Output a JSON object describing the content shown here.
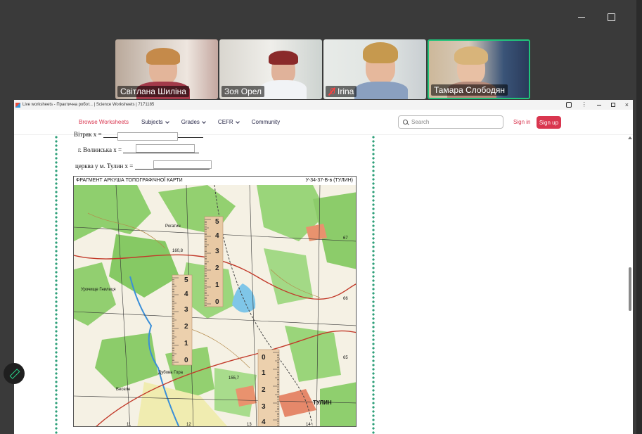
{
  "participants": [
    {
      "name": "Світлана Шиліна",
      "muted": false
    },
    {
      "name": "Зоя Орел",
      "muted": false
    },
    {
      "name": "Irina",
      "muted": true
    },
    {
      "name": "Тамара Слободян",
      "muted": false,
      "speaking": true
    }
  ],
  "browser": {
    "tab_title": "Live worksheets - Практична робот... | Science Worksheets | 7171185"
  },
  "navbar": {
    "browse": "Browse Worksheets",
    "subjects": "Subjects",
    "grades": "Grades",
    "cefr": "CEFR",
    "community": "Community",
    "search_placeholder": "Search",
    "signin": "Sign in",
    "signup": "Sign up"
  },
  "worksheet": {
    "line1": "Вітряк х =",
    "line2": "г. Волинська х =",
    "line3": "церква у м. Тулин  х =",
    "map_title": "ФРАГМЕНТ АРКУША ТОПОГРАФІЧНОЇ КАРТИ",
    "map_code": "У-34-37-В-в (ТУЛИН)",
    "grid_right": [
      "67",
      "66",
      "65"
    ],
    "grid_bottom": [
      "11",
      "12",
      "13",
      "14"
    ],
    "map_labels": [
      "160,8",
      "155,7",
      "ТУЛИН",
      "Рогатин",
      "Веселе",
      "Урочище Гнилиця",
      "Дубова Гора"
    ],
    "ruler1": [
      "0",
      "1",
      "2",
      "3",
      "4",
      "5"
    ],
    "ruler2": [
      "0",
      "1",
      "2",
      "3",
      "4",
      "5"
    ],
    "ruler3": [
      "0",
      "1",
      "2",
      "3",
      "4"
    ]
  },
  "colors": {
    "accent": "#d9364f",
    "speaking_border": "#21c47b",
    "forest": "#7cc460"
  }
}
